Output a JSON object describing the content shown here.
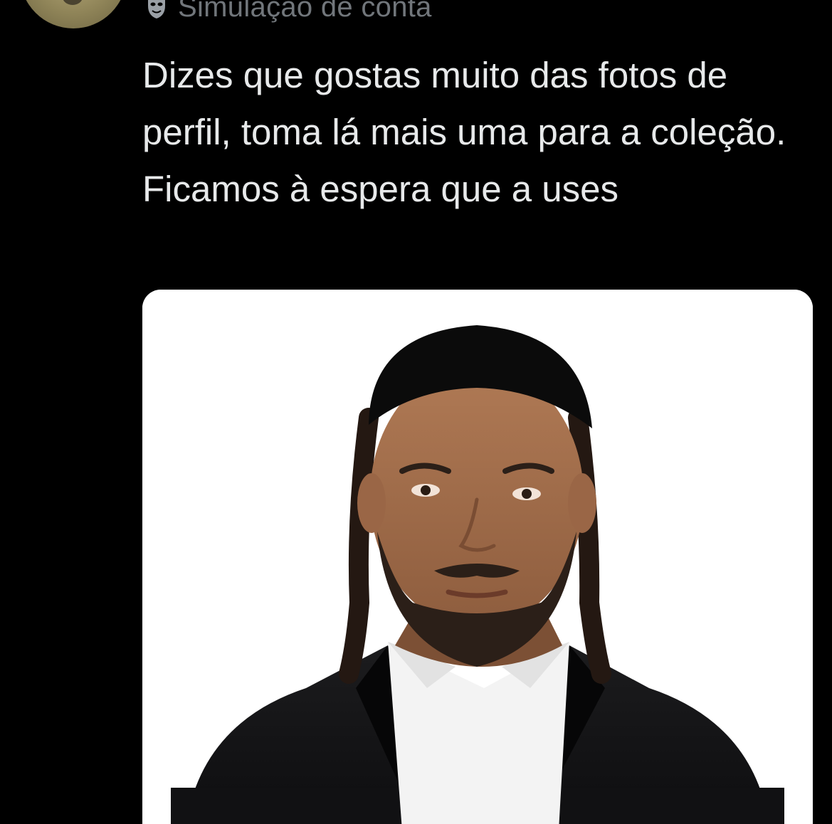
{
  "tweet": {
    "account_label": "Simulação de conta",
    "account_icon": "mask-icon",
    "text_lines": [
      "Dizes que gostas muito das fotos de perfil, toma lá mais uma para a coleção.",
      "Ficamos à espera que a uses"
    ]
  },
  "media": {
    "type": "photo",
    "alt": "portrait-photo"
  },
  "colors": {
    "background": "#000000",
    "text_primary": "#e7e9ea",
    "text_secondary": "#71767b",
    "media_background": "#ffffff"
  }
}
